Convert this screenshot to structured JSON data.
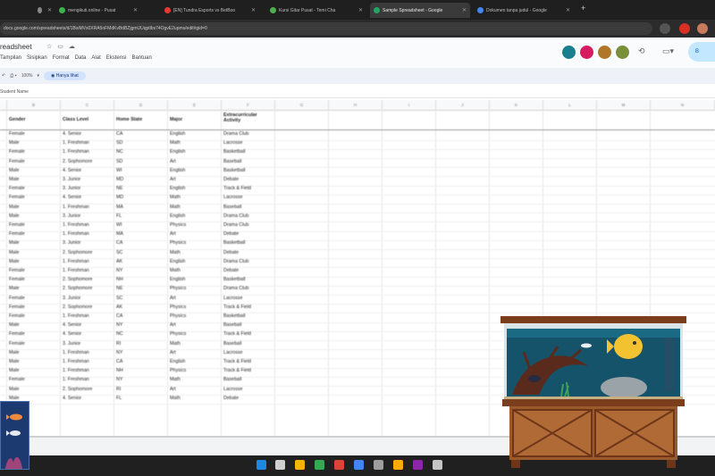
{
  "browser": {
    "tabs": [
      {
        "label": "",
        "color": "#888888"
      },
      {
        "label": "mengikuti.online - Pusat",
        "color": "#3ab44a"
      },
      {
        "label": "[EN] Tundra Esports vs BetBoo",
        "color": "#e53935"
      },
      {
        "label": "Kursi Gitar Pusat - Temi Cha",
        "color": "#4caf50"
      },
      {
        "label": "Sample Spreadsheet - Google",
        "color": "#22a565"
      },
      {
        "label": "Dokumen tanpa judul - Google",
        "color": "#4285f4"
      }
    ],
    "url": "docs.google.com/spreadsheets/d/1BxiMVs0XRA5nFMdKvBdBZjgmUUqptlbs74OgvE2upms/edit#gid=0"
  },
  "sheet": {
    "title": "readsheet",
    "menu": [
      "Tampilan",
      "Sisipkan",
      "Format",
      "Data",
      "Alat",
      "Ekstensi",
      "Bantuan"
    ],
    "zoom": "100%",
    "mode_chip": "Hanya lihat",
    "formula_cell": "Student Name",
    "share_label": "B",
    "col_letters": [
      "",
      "B",
      "C",
      "D",
      "E",
      "F",
      "G",
      "H",
      "I",
      "J",
      "K",
      "L",
      "M",
      "N"
    ],
    "headers": [
      "Gender",
      "Class Level",
      "Home State",
      "Major",
      "Extracurricular Activity"
    ],
    "rows": [
      [
        "Female",
        "4. Senior",
        "CA",
        "English",
        "Drama Club"
      ],
      [
        "Male",
        "1. Freshman",
        "SD",
        "Math",
        "Lacrosse"
      ],
      [
        "Female",
        "1. Freshman",
        "NC",
        "English",
        "Basketball"
      ],
      [
        "Female",
        "2. Sophomore",
        "SD",
        "Art",
        "Baseball"
      ],
      [
        "Male",
        "4. Senior",
        "WI",
        "English",
        "Basketball"
      ],
      [
        "Male",
        "3. Junior",
        "MD",
        "Art",
        "Debate"
      ],
      [
        "Female",
        "3. Junior",
        "NE",
        "English",
        "Track & Field"
      ],
      [
        "Female",
        "4. Senior",
        "MD",
        "Math",
        "Lacrosse"
      ],
      [
        "Male",
        "1. Freshman",
        "MA",
        "Math",
        "Baseball"
      ],
      [
        "Male",
        "3. Junior",
        "FL",
        "English",
        "Drama Club"
      ],
      [
        "Female",
        "1. Freshman",
        "WI",
        "Physics",
        "Drama Club"
      ],
      [
        "Female",
        "1. Freshman",
        "MA",
        "Art",
        "Debate"
      ],
      [
        "Male",
        "3. Junior",
        "CA",
        "Physics",
        "Basketball"
      ],
      [
        "Male",
        "2. Sophomore",
        "SC",
        "Math",
        "Debate"
      ],
      [
        "Male",
        "1. Freshman",
        "AK",
        "English",
        "Drama Club"
      ],
      [
        "Female",
        "1. Freshman",
        "NY",
        "Math",
        "Debate"
      ],
      [
        "Female",
        "2. Sophomore",
        "NH",
        "English",
        "Basketball"
      ],
      [
        "Male",
        "2. Sophomore",
        "NE",
        "Physics",
        "Drama Club"
      ],
      [
        "Female",
        "3. Junior",
        "SC",
        "Art",
        "Lacrosse"
      ],
      [
        "Female",
        "2. Sophomore",
        "AK",
        "Physics",
        "Track & Field"
      ],
      [
        "Female",
        "1. Freshman",
        "CA",
        "Physics",
        "Basketball"
      ],
      [
        "Male",
        "4. Senior",
        "NY",
        "Art",
        "Baseball"
      ],
      [
        "Female",
        "4. Senior",
        "NC",
        "Physics",
        "Track & Field"
      ],
      [
        "Female",
        "3. Junior",
        "RI",
        "Math",
        "Baseball"
      ],
      [
        "Male",
        "1. Freshman",
        "NY",
        "Art",
        "Lacrosse"
      ],
      [
        "Male",
        "1. Freshman",
        "CA",
        "English",
        "Track & Field"
      ],
      [
        "Male",
        "1. Freshman",
        "NH",
        "Physics",
        "Track & Field"
      ],
      [
        "Female",
        "1. Freshman",
        "NY",
        "Math",
        "Baseball"
      ],
      [
        "Male",
        "2. Sophomore",
        "RI",
        "Art",
        "Lacrosse"
      ],
      [
        "Male",
        "4. Senior",
        "FL",
        "Math",
        "Debate"
      ]
    ]
  },
  "taskbar": {
    "icon_colors": [
      "#1e88e5",
      "#cfcfcf",
      "#f4b400",
      "#34a853",
      "#db4437",
      "#4285f4",
      "#9e9e9e",
      "#f9ab00",
      "#8e24aa",
      "#c5c5c5"
    ]
  },
  "colors": {
    "accent": "#c2e7ff",
    "header_bg": "#f9fbfd",
    "taskbar_bg": "#202020"
  }
}
